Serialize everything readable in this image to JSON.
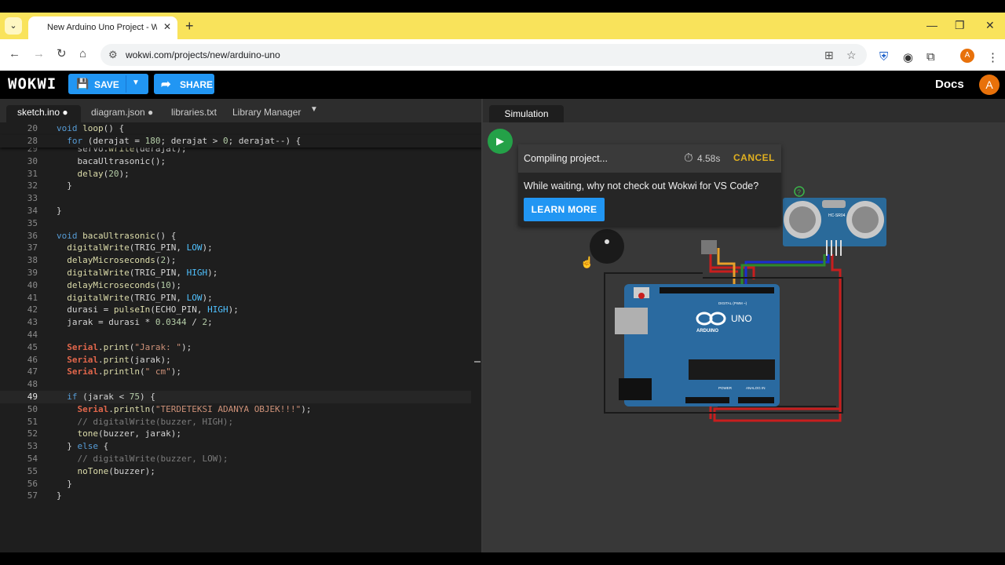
{
  "browser": {
    "tab_title": "New Arduino Uno Project - Wokwi",
    "url": "wokwi.com/projects/new/arduino-uno",
    "new_tab": "+",
    "tab_close": "✕"
  },
  "header": {
    "logo": "WOKWI",
    "save_label": "SAVE",
    "share_label": "SHARE",
    "docs_label": "Docs",
    "avatar": "A"
  },
  "editor": {
    "tabs": [
      "sketch.ino ●",
      "diagram.json ●",
      "libraries.txt",
      "Library Manager"
    ],
    "lines": [
      {
        "n": "20",
        "html": "<span class=\"kw\">void</span> <span class=\"fn\">loop</span>() {"
      },
      {
        "n": "28",
        "html": "  <span class=\"kw\">for</span> (derajat = <span class=\"num\">180</span>; derajat &gt; <span class=\"num\">0</span>; derajat--) {"
      },
      {
        "n": "29",
        "html": "    servo.<span class=\"fn\">write</span>(derajat);"
      },
      {
        "n": "30",
        "html": "    bacaUltrasonic();"
      },
      {
        "n": "31",
        "html": "    <span class=\"fn\">delay</span>(<span class=\"num\">20</span>);"
      },
      {
        "n": "32",
        "html": "  }"
      },
      {
        "n": "33",
        "html": ""
      },
      {
        "n": "34",
        "html": "}"
      },
      {
        "n": "35",
        "html": ""
      },
      {
        "n": "36",
        "html": "<span class=\"kw\">void</span> <span class=\"fn\">bacaUltrasonic</span>() {"
      },
      {
        "n": "37",
        "html": "  <span class=\"fn\">digitalWrite</span>(TRIG_PIN, <span class=\"cst\">LOW</span>);"
      },
      {
        "n": "38",
        "html": "  <span class=\"fn\">delayMicroseconds</span>(<span class=\"num\">2</span>);"
      },
      {
        "n": "39",
        "html": "  <span class=\"fn\">digitalWrite</span>(TRIG_PIN, <span class=\"cst\">HIGH</span>);"
      },
      {
        "n": "40",
        "html": "  <span class=\"fn\">delayMicroseconds</span>(<span class=\"num\">10</span>);"
      },
      {
        "n": "41",
        "html": "  <span class=\"fn\">digitalWrite</span>(TRIG_PIN, <span class=\"cst\">LOW</span>);"
      },
      {
        "n": "42",
        "html": "  durasi = <span class=\"fn\">pulseIn</span>(ECHO_PIN, <span class=\"cst\">HIGH</span>);"
      },
      {
        "n": "43",
        "html": "  jarak = durasi * <span class=\"num\">0.0344</span> / <span class=\"num\">2</span>;"
      },
      {
        "n": "44",
        "html": ""
      },
      {
        "n": "45",
        "html": "  <span class=\"cls\">Serial</span>.<span class=\"fn\">print</span>(<span class=\"str\">\"Jarak: \"</span>);"
      },
      {
        "n": "46",
        "html": "  <span class=\"cls\">Serial</span>.<span class=\"fn\">print</span>(jarak);"
      },
      {
        "n": "47",
        "html": "  <span class=\"cls\">Serial</span>.<span class=\"fn\">println</span>(<span class=\"str\">\" cm\"</span>);"
      },
      {
        "n": "48",
        "html": ""
      },
      {
        "n": "49",
        "html": "  <span class=\"kw\">if</span> (jarak &lt; <span class=\"num\">75</span>) {"
      },
      {
        "n": "50",
        "html": "    <span class=\"cls\">Serial</span>.<span class=\"fn\">println</span>(<span class=\"str\">\"TERDETEKSI ADANYA OBJEK!!!\"</span>);"
      },
      {
        "n": "51",
        "html": "    <span class=\"cmt\">// digitalWrite(buzzer, HIGH);</span>"
      },
      {
        "n": "52",
        "html": "    <span class=\"fn\">tone</span>(buzzer, jarak);"
      },
      {
        "n": "53",
        "html": "  } <span class=\"kw\">else</span> {"
      },
      {
        "n": "54",
        "html": "    <span class=\"cmt\">// digitalWrite(buzzer, LOW);</span>"
      },
      {
        "n": "55",
        "html": "    <span class=\"fn\">noTone</span>(buzzer);"
      },
      {
        "n": "56",
        "html": "  }"
      },
      {
        "n": "57",
        "html": "}"
      }
    ]
  },
  "simulation": {
    "tab_label": "Simulation",
    "compiling_text": "Compiling project...",
    "timer": "4.58s",
    "cancel_label": "CANCEL",
    "waiting_text": "While waiting, why not check out Wokwi for VS Code?",
    "learn_more_label": "LEARN MORE",
    "board_label_uno": "UNO",
    "board_label_arduino": "ARDUINO",
    "sensor_label": "HC-SR04",
    "digital_label": "DIGITAL (PWM ~)",
    "power_label": "POWER",
    "analog_label": "ANALOG IN"
  },
  "colors": {
    "accent": "#2196f3",
    "play": "#24a148",
    "tabstrip": "#f9e35b",
    "cancel": "#e0b020"
  }
}
